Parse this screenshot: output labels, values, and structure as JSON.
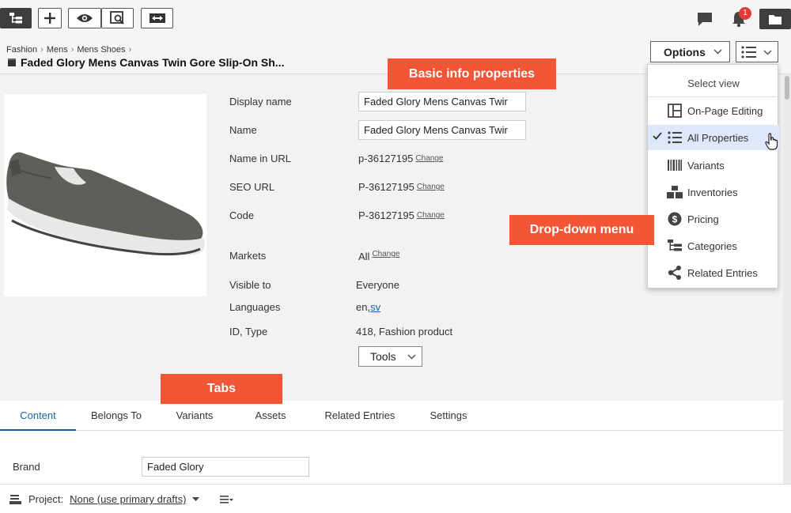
{
  "toolbar": {
    "notification_count": "1"
  },
  "breadcrumb": {
    "items": [
      "Fashion",
      "Mens",
      "Mens Shoes"
    ]
  },
  "page": {
    "title": "Faded Glory Mens Canvas Twin Gore Slip-On Sh..."
  },
  "header": {
    "options_label": "Options"
  },
  "properties": {
    "display_name_label": "Display name",
    "display_name_value": "Faded Glory Mens Canvas Twir",
    "name_label": "Name",
    "name_value": "Faded Glory Mens Canvas Twir",
    "name_in_url_label": "Name in URL",
    "name_in_url_value": "p-36127195",
    "seo_url_label": "SEO URL",
    "seo_url_value": "P-36127195",
    "code_label": "Code",
    "code_value": "P-36127195",
    "markets_label": "Markets",
    "markets_value": "All",
    "visible_to_label": "Visible to",
    "visible_to_value": "Everyone",
    "languages_label": "Languages",
    "languages_value_en": "en,",
    "languages_value_sv": "sv",
    "id_type_label": "ID, Type",
    "id_type_value": "418, Fashion product",
    "change_label": "Change",
    "tools_label": "Tools"
  },
  "tabs": [
    {
      "label": "Content"
    },
    {
      "label": "Belongs To"
    },
    {
      "label": "Variants"
    },
    {
      "label": "Assets"
    },
    {
      "label": "Related Entries"
    },
    {
      "label": "Settings"
    }
  ],
  "content": {
    "brand_label": "Brand",
    "brand_value": "Faded Glory"
  },
  "footer": {
    "project_label": "Project:",
    "project_value": "None (use primary drafts)"
  },
  "dropdown": {
    "heading": "Select view",
    "items": [
      {
        "label": "On-Page Editing",
        "icon": "layout-icon"
      },
      {
        "label": "All Properties",
        "icon": "list-icon"
      },
      {
        "label": "Variants",
        "icon": "barcode-icon"
      },
      {
        "label": "Inventories",
        "icon": "boxes-icon"
      },
      {
        "label": "Pricing",
        "icon": "dollar-icon"
      },
      {
        "label": "Categories",
        "icon": "tree-icon"
      },
      {
        "label": "Related Entries",
        "icon": "share-icon"
      }
    ]
  },
  "callouts": {
    "basic_info": "Basic info properties",
    "dropdown_menu": "Drop-down menu",
    "tabs": "Tabs"
  },
  "colors": {
    "accent": "#1a5fb4",
    "callout": "#f25637",
    "badge": "#e53935"
  }
}
